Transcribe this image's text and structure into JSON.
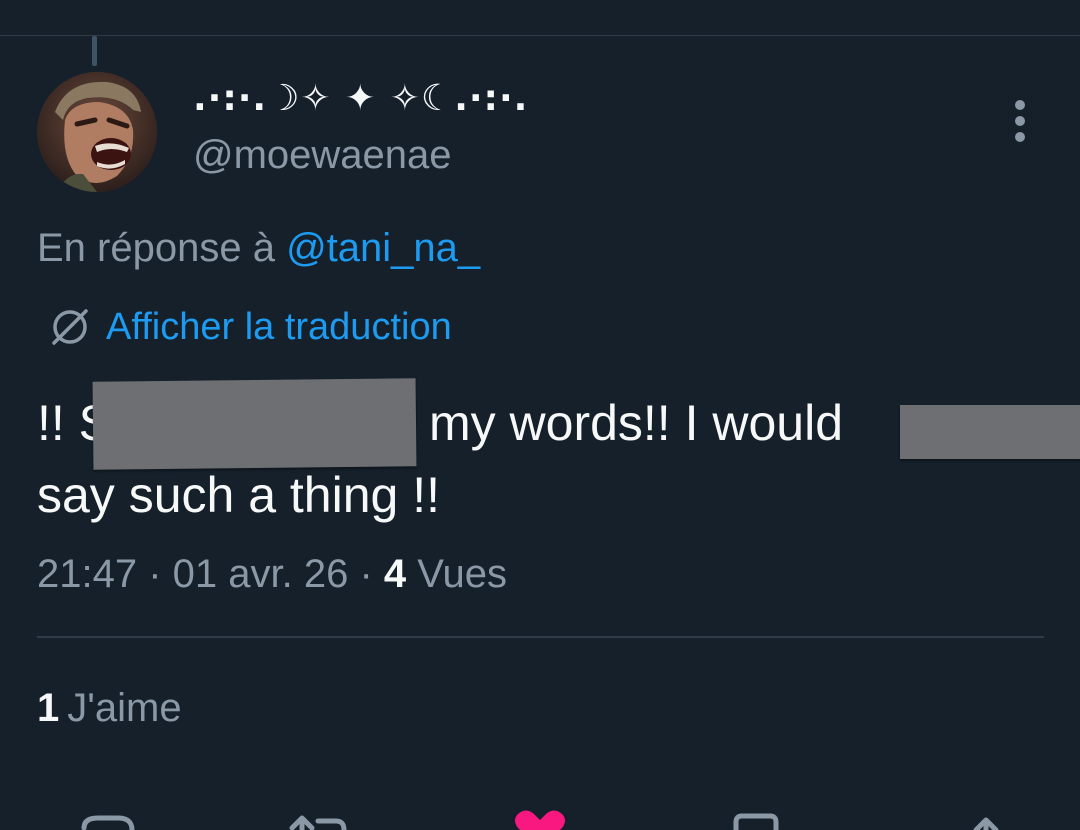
{
  "author": {
    "display_name": ".·:·.☽✧ ✦ ✧☾.·:·.",
    "handle": "@moewaenae",
    "avatar_icon": "avatar-photo"
  },
  "reply": {
    "prefix": "En réponse à ",
    "mention": "@tani_na_"
  },
  "translate": {
    "label": "Afficher la traduction",
    "icon": "globe-slash-icon"
  },
  "tweet": {
    "line1_part1": "!! S",
    "line1_part2": "my words!! I would",
    "line2": "say such a thing !!"
  },
  "meta": {
    "time": "21:47",
    "separator": " · ",
    "date": "01 avr. 26",
    "views_count": "4",
    "views_label": " Vues"
  },
  "likes": {
    "count": "1",
    "label": "J'aime"
  },
  "actions": {
    "reply_icon": "reply-icon",
    "retweet_icon": "retweet-icon",
    "like_icon": "heart-icon",
    "bookmark_icon": "bookmark-icon",
    "share_icon": "share-icon"
  },
  "colors": {
    "background": "#15202b",
    "link": "#1d9bf0",
    "secondary_text": "#8b98a5",
    "primary_text": "#f7f9f9",
    "like": "#f91880"
  }
}
